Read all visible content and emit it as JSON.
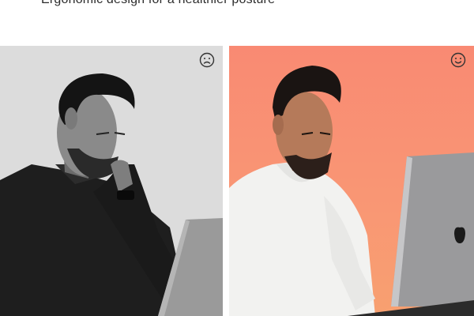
{
  "headline": "Ergonomic design for a healthier posture",
  "panels": [
    {
      "mood_icon": "frown-face-icon"
    },
    {
      "mood_icon": "smile-face-icon"
    }
  ]
}
